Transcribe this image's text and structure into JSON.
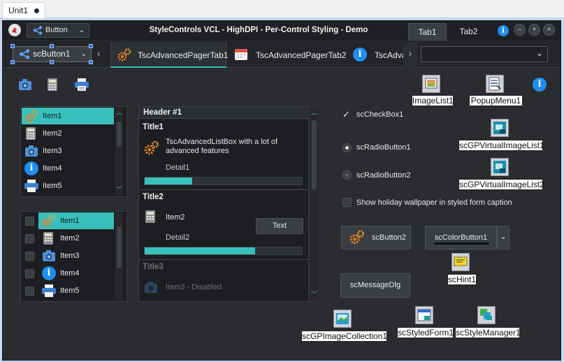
{
  "ide": {
    "unit_tab": "Unit1"
  },
  "form": {
    "title": "StyleControls VCL - HighDPI - Per-Control Styling - Demo",
    "combo_label": "Button",
    "tabs": [
      "Tab1",
      "Tab2"
    ],
    "win_buttons": [
      "–",
      "+",
      "×"
    ]
  },
  "pager": {
    "button": "scButton1",
    "tabs": [
      "TscAdvancedPagerTab1",
      "TscAdvancedPagerTab2",
      "TscAdva"
    ]
  },
  "list1": [
    "Item1",
    "Item2",
    "Item3",
    "Item4",
    "Item5"
  ],
  "list2": [
    "Item1",
    "Item2",
    "Item3",
    "Item4",
    "Item5"
  ],
  "adv_list": {
    "header": "Header #1",
    "sections": [
      {
        "title": "Title1",
        "text": "TscAdvancedListBox with a lot of advanced features",
        "detail": "Detail1",
        "progress": 0.3
      },
      {
        "title": "Title2",
        "text": "Item2",
        "detail": "Detail2",
        "progress": 0.7,
        "button": "Text"
      },
      {
        "title": "Title3",
        "text": "Item3 - Disabled"
      }
    ]
  },
  "controls": {
    "checkbox": "scCheckBox1",
    "radio1": "scRadioButton1",
    "radio2": "scRadioButton2",
    "wallpaper_check": "Show holiday wallpaper in styled form caption",
    "button2": "scButton2",
    "color_button": "scColorButton1",
    "message_dlg": "scMessageDlg"
  },
  "nonvisual": {
    "image_list": "ImageList1",
    "popup_menu": "PopupMenu1",
    "virtual_list1": "scGPVirtualImageList1",
    "virtual_list2": "scGPVirtualImageList2",
    "hint": "scHint1",
    "image_collection": "scGPImageCollection1",
    "styled_form": "scStyledForm1",
    "style_manager": "scStyleManager1"
  },
  "colors": {
    "accent": "#38c0bc",
    "info": "#1f8ef1",
    "form_bg": "#2a2c30"
  }
}
